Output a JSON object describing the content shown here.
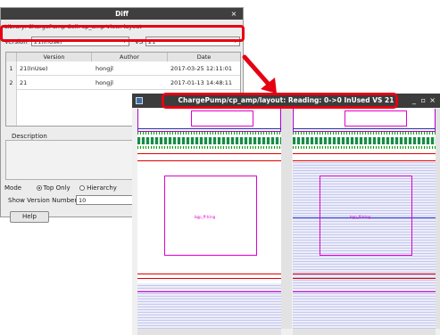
{
  "diff_dialog": {
    "title": "Diff",
    "close_glyph": "×",
    "library_line": "Library: ChargePump Cell: cp_amp View: layout",
    "version_label": "Version",
    "version_value": "21(InUse)",
    "vs_label": "VS",
    "vs_value": "21",
    "dropdown_glyph": "▾",
    "table": {
      "headers": [
        "Version",
        "Author",
        "Date"
      ],
      "rows": [
        {
          "num": "1",
          "version": "21(InUse)",
          "author": "hongjl",
          "date": "2017-03-25 12:11:01"
        },
        {
          "num": "2",
          "version": "21",
          "author": "hongjl",
          "date": "2017-01-13 14:48:11"
        }
      ]
    },
    "description_label": "Description",
    "mode_label": "Mode",
    "mode_options": [
      "Top Only",
      "Hierarchy"
    ],
    "mode_selected": "Top Only",
    "show_version_label": "Show Version Number",
    "show_version_value": "10",
    "help_label": "Help"
  },
  "layout_window": {
    "title": "ChargePump/cp_amp/layout: Reading: 0->0  InUsed  VS  21",
    "minimize_glyph": "_",
    "maximize_glyph": "▫",
    "close_glyph": "×",
    "left_cell_label": "bgp_ff-tring",
    "right_cell_label": "bgp_ff-tring"
  },
  "colors": {
    "highlight": "#e60012",
    "arrow": "#e60012",
    "layout_magenta": "#e000d0"
  }
}
